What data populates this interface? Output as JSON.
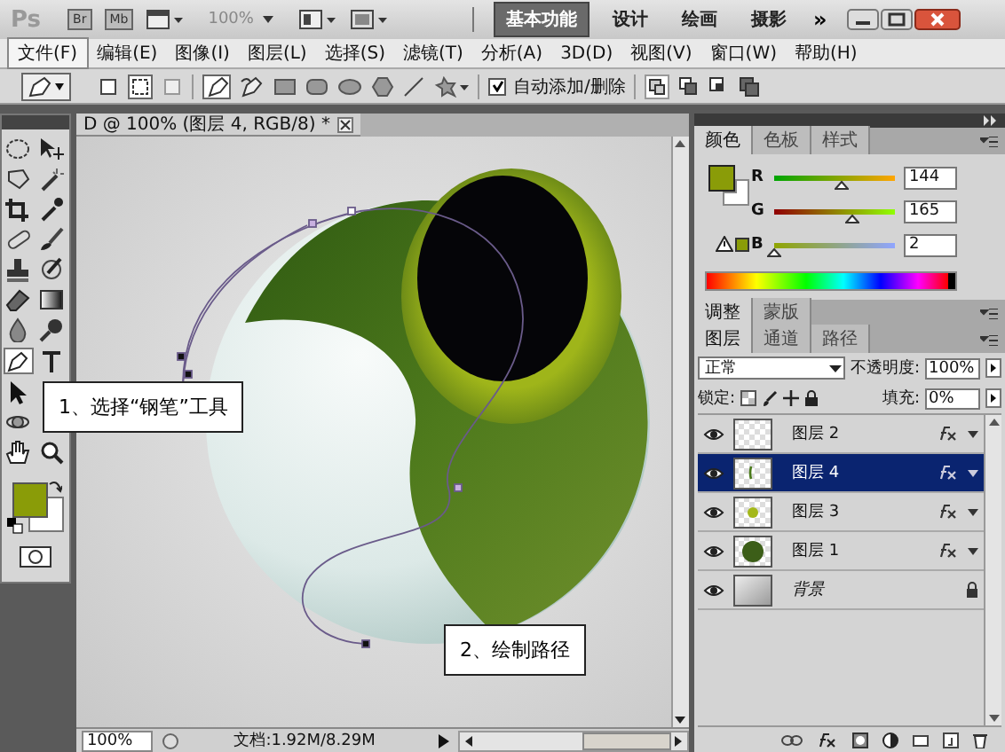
{
  "app_bar": {
    "logo": "Ps",
    "bridge": "Br",
    "mini_bridge": "Mb",
    "zoom": "100%",
    "more": "»",
    "workspaces": [
      {
        "label": "基本功能",
        "selected": true
      },
      {
        "label": "设计",
        "selected": false
      },
      {
        "label": "绘画",
        "selected": false
      },
      {
        "label": "摄影",
        "selected": false
      }
    ]
  },
  "menu": [
    {
      "label": "文件(F)",
      "selected": true
    },
    {
      "label": "编辑(E)",
      "selected": false
    },
    {
      "label": "图像(I)",
      "selected": false
    },
    {
      "label": "图层(L)",
      "selected": false
    },
    {
      "label": "选择(S)",
      "selected": false
    },
    {
      "label": "滤镜(T)",
      "selected": false
    },
    {
      "label": "分析(A)",
      "selected": false
    },
    {
      "label": "3D(D)",
      "selected": false
    },
    {
      "label": "视图(V)",
      "selected": false
    },
    {
      "label": "窗口(W)",
      "selected": false
    },
    {
      "label": "帮助(H)",
      "selected": false
    }
  ],
  "options_bar": {
    "auto_add_delete": {
      "label": "自动添加/删除",
      "checked": true
    }
  },
  "document": {
    "tab_title": "D @ 100% (图层 4, RGB/8) *"
  },
  "callouts": [
    "1、选择“钢笔”工具",
    "2、绘制路径"
  ],
  "status_bar": {
    "zoom": "100%",
    "doc_info": "文档:1.92M/8.29M"
  },
  "color_panel": {
    "tabs": [
      {
        "label": "颜色",
        "selected": true
      },
      {
        "label": "色板",
        "selected": false
      },
      {
        "label": "样式",
        "selected": false
      }
    ],
    "channels": [
      {
        "name": "R",
        "value": "144",
        "level": 0.565
      },
      {
        "name": "G",
        "value": "165",
        "level": 0.647
      },
      {
        "name": "B",
        "value": "2",
        "level": 0.008
      }
    ]
  },
  "adjust_tabs": [
    {
      "label": "调整",
      "selected": true
    },
    {
      "label": "蒙版",
      "selected": false
    }
  ],
  "layers_panel": {
    "tabs": [
      {
        "label": "图层",
        "selected": true
      },
      {
        "label": "通道",
        "selected": false
      },
      {
        "label": "路径",
        "selected": false
      }
    ],
    "blend_mode": "正常",
    "opacity_label": "不透明度:",
    "opacity": "100%",
    "lock_label": "锁定:",
    "fill_label": "填充:",
    "fill": "0%",
    "layers": [
      {
        "name": "图层 2",
        "kind": "empty",
        "fx": true,
        "locked": false,
        "selected": false
      },
      {
        "name": "图层 4",
        "kind": "stroke",
        "fx": true,
        "locked": false,
        "selected": true
      },
      {
        "name": "图层 3",
        "kind": "small-dot",
        "fx": true,
        "locked": false,
        "selected": false
      },
      {
        "name": "图层 1",
        "kind": "large-dot",
        "fx": true,
        "locked": false,
        "selected": false
      },
      {
        "name": "背景",
        "kind": "gradient",
        "fx": false,
        "locked": true,
        "selected": false
      }
    ]
  }
}
